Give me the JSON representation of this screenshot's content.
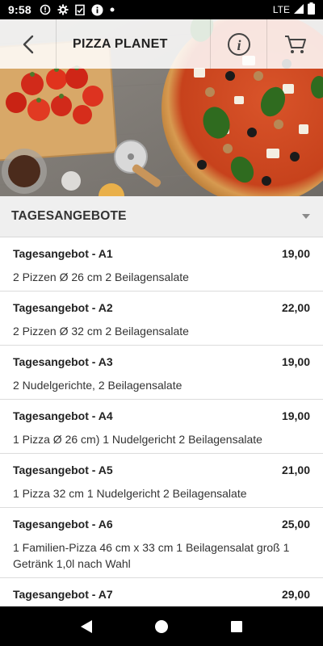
{
  "status_bar": {
    "time": "9:58",
    "network": "LTE"
  },
  "app_bar": {
    "title": "PIZZA PLANET"
  },
  "section": {
    "title": "TAGESANGEBOTE"
  },
  "offers": [
    {
      "name": "Tagesangebot - A1",
      "price": "19,00",
      "desc": "2 Pizzen Ø 26 cm 2 Beilagensalate"
    },
    {
      "name": "Tagesangebot - A2",
      "price": "22,00",
      "desc": "2 Pizzen Ø 32 cm 2 Beilagensalate"
    },
    {
      "name": "Tagesangebot - A3",
      "price": "19,00",
      "desc": "2 Nudelgerichte, 2 Beilagensalate"
    },
    {
      "name": "Tagesangebot - A4",
      "price": "19,00",
      "desc": "1 Pizza Ø 26 cm) 1 Nudelgericht 2 Beilagensalate"
    },
    {
      "name": "Tagesangebot - A5",
      "price": "21,00",
      "desc": "1 Pizza 32 cm 1 Nudelgericht 2 Beilagensalate"
    },
    {
      "name": "Tagesangebot - A6",
      "price": "25,00",
      "desc": "1 Familien-Pizza 46 cm x 33 cm 1 Beilagensalat groß 1 Getränk 1,0l nach Wahl"
    },
    {
      "name": "Tagesangebot - A7",
      "price": "29,00",
      "desc": ""
    }
  ],
  "icons": {
    "back": "back-arrow-icon",
    "info": "info-icon",
    "cart": "cart-icon"
  },
  "colors": {
    "section_bg": "#efefef",
    "status_bg": "#000000"
  }
}
